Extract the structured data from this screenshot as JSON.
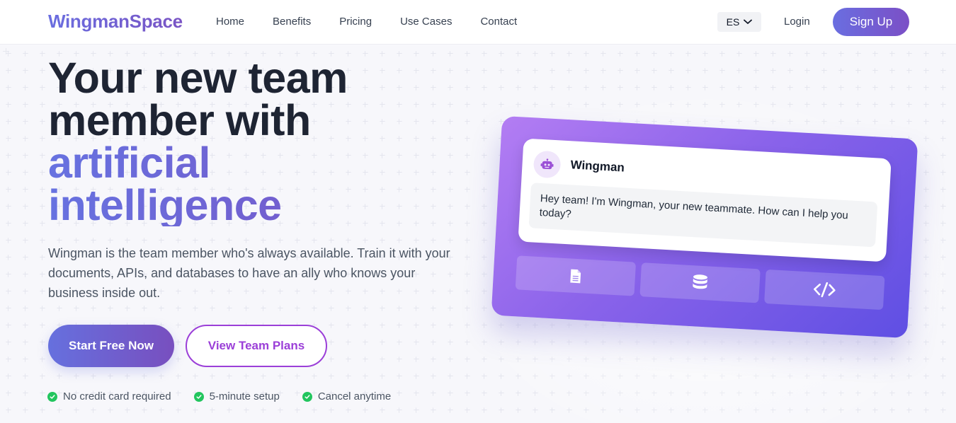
{
  "brand": {
    "name": "WingmanSpace"
  },
  "nav": {
    "items": [
      {
        "label": "Home"
      },
      {
        "label": "Benefits"
      },
      {
        "label": "Pricing"
      },
      {
        "label": "Use Cases"
      },
      {
        "label": "Contact"
      }
    ]
  },
  "header": {
    "language": "ES",
    "login_label": "Login",
    "signup_label": "Sign Up"
  },
  "hero": {
    "title_line1": "Your new team",
    "title_line2": "member with",
    "title_accent1": "artificial",
    "title_accent2": "intelligence",
    "description": "Wingman is the team member who's always available. Train it with your documents, APIs, and databases to have an ally who knows your business inside out.",
    "primary_cta": "Start Free Now",
    "secondary_cta": "View Team Plans",
    "perks": [
      {
        "label": "No credit card required"
      },
      {
        "label": "5-minute setup"
      },
      {
        "label": "Cancel anytime"
      }
    ]
  },
  "chat_card": {
    "bot_name": "Wingman",
    "message": "Hey team! I'm Wingman, your new teammate. How can I help you today?",
    "tiles": [
      {
        "icon": "document-icon"
      },
      {
        "icon": "database-icon"
      },
      {
        "icon": "code-icon"
      }
    ]
  },
  "colors": {
    "accent_start": "#6a6ee0",
    "accent_end": "#7b4fc6",
    "secondary_border": "#9b3fd8",
    "success": "#22c55e"
  }
}
